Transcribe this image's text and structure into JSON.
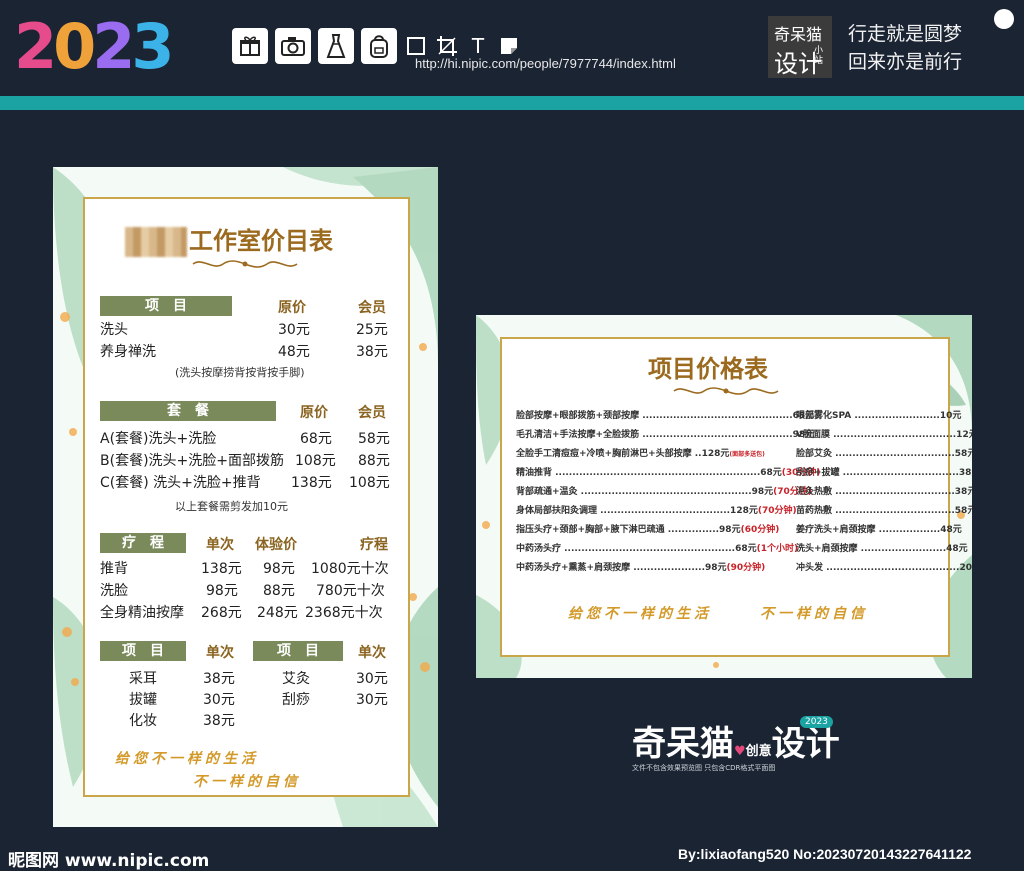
{
  "banner": {
    "logo_chars": [
      "2",
      "0",
      "2",
      "3"
    ],
    "url": "http://hi.nipic.com/people/7977744/index.html",
    "brand_line1": "奇呆猫",
    "brand_line2": "设计",
    "brand_line3": "小站",
    "slogan_line1": "行走就是圆梦",
    "slogan_line2": "回来亦是前行",
    "tool_icons": [
      "gift-icon",
      "camera-icon",
      "dress-icon",
      "backpack-icon",
      "square-icon",
      "crop-icon",
      "text-icon",
      "layer-icon"
    ],
    "tool_text_glyph": "T"
  },
  "left_card": {
    "title_suffix": "工作室价目表",
    "section1": {
      "label": "项　目",
      "col1": "原价",
      "col2": "会员",
      "rows": [
        {
          "name": "洗头",
          "price": "30元",
          "member": "25元"
        },
        {
          "name": "养身禅洗",
          "price": "48元",
          "member": "38元"
        }
      ],
      "note": "(洗头按摩捞背按背按手脚)"
    },
    "section2": {
      "label": "套　餐",
      "col1": "原价",
      "col2": "会员",
      "rows": [
        {
          "name": "A(套餐)洗头+洗脸",
          "price": "68元",
          "member": "58元"
        },
        {
          "name": "B(套餐)洗头+洗脸+面部拨筋",
          "price": "108元",
          "member": "88元"
        },
        {
          "name": "C(套餐) 洗头+洗脸+推背",
          "price": "138元",
          "member": "108元"
        }
      ],
      "note": "以上套餐需剪发加10元"
    },
    "section3": {
      "label": "疗　程",
      "col1": "单次",
      "col2": "体验价",
      "col3": "疗程",
      "rows": [
        {
          "name": "推背",
          "single": "138元",
          "trial": "98元",
          "course": "1080元十次"
        },
        {
          "name": "洗脸",
          "single": "98元",
          "trial": "88元",
          "course": "780元十次"
        },
        {
          "name": "全身精油按摩",
          "single": "268元",
          "trial": "248元",
          "course": "2368元十次"
        }
      ]
    },
    "section4": {
      "label_left": "项　目",
      "col_left": "单次",
      "label_right": "项　目",
      "col_right": "单次",
      "rows_left": [
        {
          "name": "采耳",
          "price": "38元"
        },
        {
          "name": "拔罐",
          "price": "30元"
        },
        {
          "name": "化妆",
          "price": "38元"
        }
      ],
      "rows_right": [
        {
          "name": "艾灸",
          "price": "30元"
        },
        {
          "name": "刮痧",
          "price": "30元"
        }
      ]
    },
    "motto1": "给您不一样的生活",
    "motto2": "不一样的自信"
  },
  "right_card": {
    "title": "项目价格表",
    "left_items": [
      {
        "text": "脸部按摩+眼部拨筋+颈部按摩 ............................................68元",
        "extra": ""
      },
      {
        "text": "毛孔清洁+手法按摩+全脸拨筋 ............................................98元",
        "extra": ""
      },
      {
        "text": "全脸手工清痘痘+冷喷+胸前淋巴+头部按摩 ..128元",
        "extra": "(面部多送包)"
      },
      {
        "text": "精油推背 ............................................................68元",
        "extra": "(30分钟)"
      },
      {
        "text": "背部疏通+温灸 ..................................................98元",
        "extra": "(70分钟)"
      },
      {
        "text": "身体局部扶阳灸调理 ......................................128元",
        "extra": "(70分钟)"
      },
      {
        "text": "指压头疗+颈部+胸部+腋下淋巴疏通 ...............98元",
        "extra": "(60分钟)"
      },
      {
        "text": "中药汤头疗 ..................................................68元",
        "extra": "(1个小时)"
      },
      {
        "text": "中药汤头疗+熏蒸+肩颈按摩 .....................98元",
        "extra": "(90分钟)"
      }
    ],
    "right_items": [
      "眼部雾化SPA .........................10元",
      "V脸面膜 ....................................12元",
      "脸部艾灸 ...................................58元",
      "刮痧+拔罐 ..................................38元",
      "泥灸热敷 ...................................38元",
      "苗药热敷 ...................................58元",
      "姜疗洗头+肩颈按摩 ..................48元",
      "洗头+肩颈按摩 .........................48元",
      "冲头发 .......................................20元"
    ],
    "motto1": "给您不一样的生活",
    "motto2": "不一样的自信"
  },
  "bottom": {
    "brand_a": "奇",
    "brand_b": "呆猫",
    "brand_heart": "♥",
    "brand_small": "创意",
    "brand_c": "设计",
    "brand_year": "2023",
    "brand_sub": "文件不包含效果预览图 只包含CDR格式平面图",
    "footer_left": "昵图网 www.nipic.com",
    "footer_right": "By:lixiaofang520 No:20230720143227641122"
  },
  "colors": {
    "background": "#1b2433",
    "teal_strip": "#1ba3a3",
    "gold_frame": "#c9a64a",
    "label_green": "#7a8a5a",
    "title_brown": "#9b6a1e",
    "motto_gold": "#d39a2a",
    "accent_red": "#c8232a"
  }
}
